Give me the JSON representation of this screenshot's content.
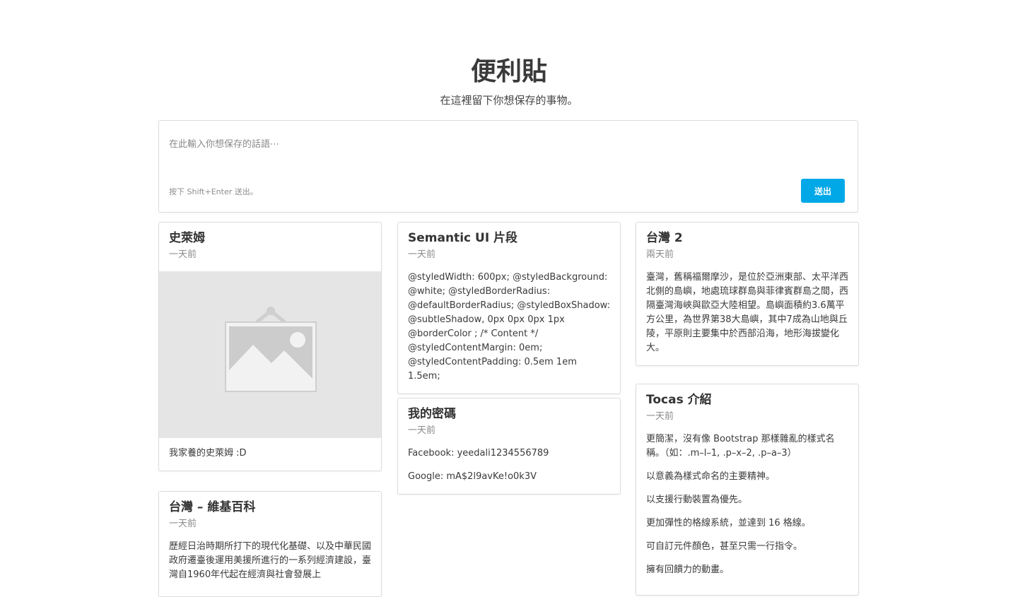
{
  "header": {
    "title": "便利貼",
    "subtitle": "在這裡留下你想保存的事物。"
  },
  "composer": {
    "placeholder": "在此輸入你想保存的話語⋯",
    "hint": "按下 Shift+Enter 送出。",
    "send_label": "送出",
    "send_color": "#00a8e8"
  },
  "notes": [
    {
      "title": "史萊姆",
      "time": "一天前",
      "image_icon": "image-placeholder-icon",
      "caption": "我家養的史萊姆 :D"
    },
    {
      "title": "台灣 – 維基百科",
      "time": "一天前",
      "text": "歷經日治時期所打下的現代化基礎、以及中華民國政府遷臺後運用美援所進行的一系列經濟建設，臺灣自1960年代起在經濟與社會發展上"
    },
    {
      "title": "Semantic UI 片段",
      "time": "一天前",
      "text": "@styledWidth: 600px; @styledBackground: @white; @styledBorderRadius: @defaultBorderRadius; @styledBoxShadow: @subtleShadow, 0px 0px 0px 1px @borderColor ; /* Content */ @styledContentMargin: 0em; @styledContentPadding: 0.5em 1em 1.5em;"
    },
    {
      "title": "我的密碼",
      "time": "一天前",
      "lines": [
        "Facebook: yeedali1234556789",
        "Google: mA$2l9avKe!o0k3V"
      ]
    },
    {
      "title": "台灣 2",
      "time": "兩天前",
      "text": "臺灣，舊稱福爾摩沙，是位於亞洲東部、太平洋西北側的島嶼，地處琉球群島與菲律賓群島之間，西隔臺灣海峽與歐亞大陸相望。島嶼面積約3.6萬平方公里，為世界第38大島嶼，其中7成為山地與丘陵，平原則主要集中於西部沿海，地形海拔變化大。"
    },
    {
      "title": "Tocas 介紹",
      "time": "一天前",
      "lines": [
        "更簡潔，沒有像 Bootstrap 那樣雜亂的樣式名稱。（如：.m–l–1, .p–x–2, .p–a–3）",
        "以意義為樣式命名的主要精神。",
        "以支援行動裝置為優先。",
        "更加彈性的格線系統，並達到 16 格線。",
        "可自訂元件顏色，甚至只需一行指令。",
        "擁有回饋力的動畫。"
      ]
    }
  ]
}
